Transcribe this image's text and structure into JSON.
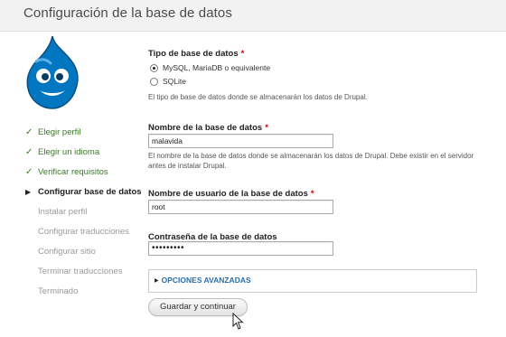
{
  "header": {
    "title": "Configuración de la base de datos"
  },
  "sidebar": {
    "tasks": [
      {
        "label": "Elegir perfil",
        "state": "done",
        "mark": "✓"
      },
      {
        "label": "Elegir un idioma",
        "state": "done",
        "mark": "✓"
      },
      {
        "label": "Verificar requisitos",
        "state": "done",
        "mark": "✓"
      },
      {
        "label": "Configurar base de datos",
        "state": "active",
        "mark": "▶"
      },
      {
        "label": "Instalar perfil",
        "state": "pending",
        "mark": ""
      },
      {
        "label": "Configurar traducciones",
        "state": "pending",
        "mark": ""
      },
      {
        "label": "Configurar sitio",
        "state": "pending",
        "mark": ""
      },
      {
        "label": "Terminar traducciones",
        "state": "pending",
        "mark": ""
      },
      {
        "label": "Terminado",
        "state": "pending",
        "mark": ""
      }
    ]
  },
  "form": {
    "db_type": {
      "label": "Tipo de base de datos",
      "required_mark": "*",
      "options": [
        {
          "label": "MySQL, MariaDB o equivalente",
          "checked": true
        },
        {
          "label": "SQLite",
          "checked": false
        }
      ],
      "description": "El tipo de base de datos donde se almacenarán los datos de Drupal."
    },
    "db_name": {
      "label": "Nombre de la base de datos",
      "required_mark": "*",
      "value": "malavida",
      "description": "El nombre de la base de datos donde se almacenarán los datos de Drupal. Debe existir en el servidor antes de instalar Drupal."
    },
    "db_user": {
      "label": "Nombre de usuario de la base de datos",
      "required_mark": "*",
      "value": "root"
    },
    "db_pass": {
      "label": "Contraseña de la base de datos",
      "value": "•••••••••"
    },
    "advanced": {
      "label": "OPCIONES AVANZADAS"
    },
    "submit_label": "Guardar y continuar"
  },
  "colors": {
    "done": "#3c7a2a",
    "link": "#2a6ea8",
    "required": "#d00000",
    "drupal_blue": "#0077c0"
  },
  "icons": {
    "logo": "drupal-drop-logo",
    "done_mark": "check-icon",
    "active_mark": "triangle-right-icon",
    "legend_caret": "triangle-right-icon",
    "cursor": "mouse-pointer-icon"
  }
}
